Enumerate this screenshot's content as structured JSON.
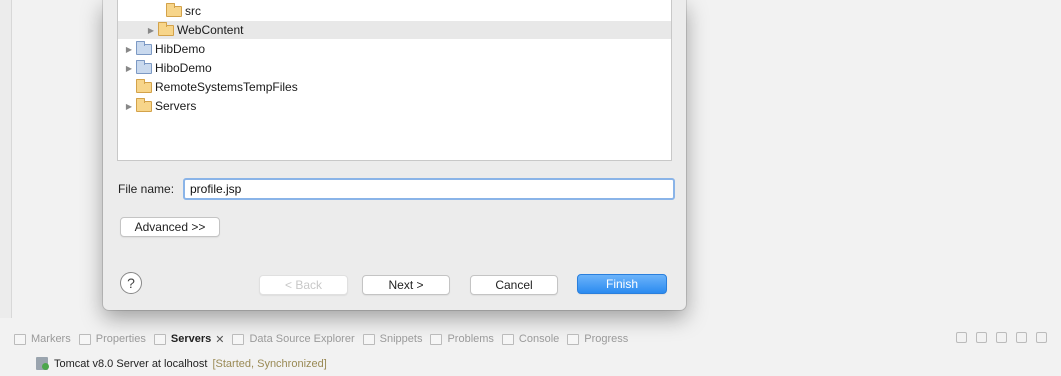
{
  "tree": {
    "items": [
      {
        "label": "src",
        "kind": "folder",
        "expandable": false
      },
      {
        "label": "WebContent",
        "kind": "folder",
        "expandable": true
      },
      {
        "label": "HibDemo",
        "kind": "project",
        "expandable": true
      },
      {
        "label": "HiboDemo",
        "kind": "project",
        "expandable": true
      },
      {
        "label": "RemoteSystemsTempFiles",
        "kind": "folder",
        "expandable": false
      },
      {
        "label": "Servers",
        "kind": "folder",
        "expandable": true
      }
    ]
  },
  "form": {
    "file_name_label": "File name:",
    "file_name_value": "profile.jsp",
    "advanced_label": "Advanced >>"
  },
  "buttons": {
    "help": "?",
    "back": "< Back",
    "next": "Next >",
    "cancel": "Cancel",
    "finish": "Finish"
  },
  "views": {
    "tabs": [
      {
        "label": "Markers",
        "icon": "markers-icon"
      },
      {
        "label": "Properties",
        "icon": "properties-icon"
      },
      {
        "label": "Servers",
        "icon": "servers-icon",
        "active": true
      },
      {
        "label": "Data Source Explorer",
        "icon": "data-source-icon"
      },
      {
        "label": "Snippets",
        "icon": "snippets-icon"
      },
      {
        "label": "Problems",
        "icon": "problems-icon"
      },
      {
        "label": "Console",
        "icon": "console-icon"
      },
      {
        "label": "Progress",
        "icon": "progress-icon"
      }
    ],
    "close_glyph": "✕"
  },
  "server": {
    "name": "Tomcat v8.0 Server at localhost",
    "status": "[Started, Synchronized]"
  },
  "colors": {
    "finish_button": "#2b8bf0",
    "input_focus": "#8ab4e8"
  }
}
